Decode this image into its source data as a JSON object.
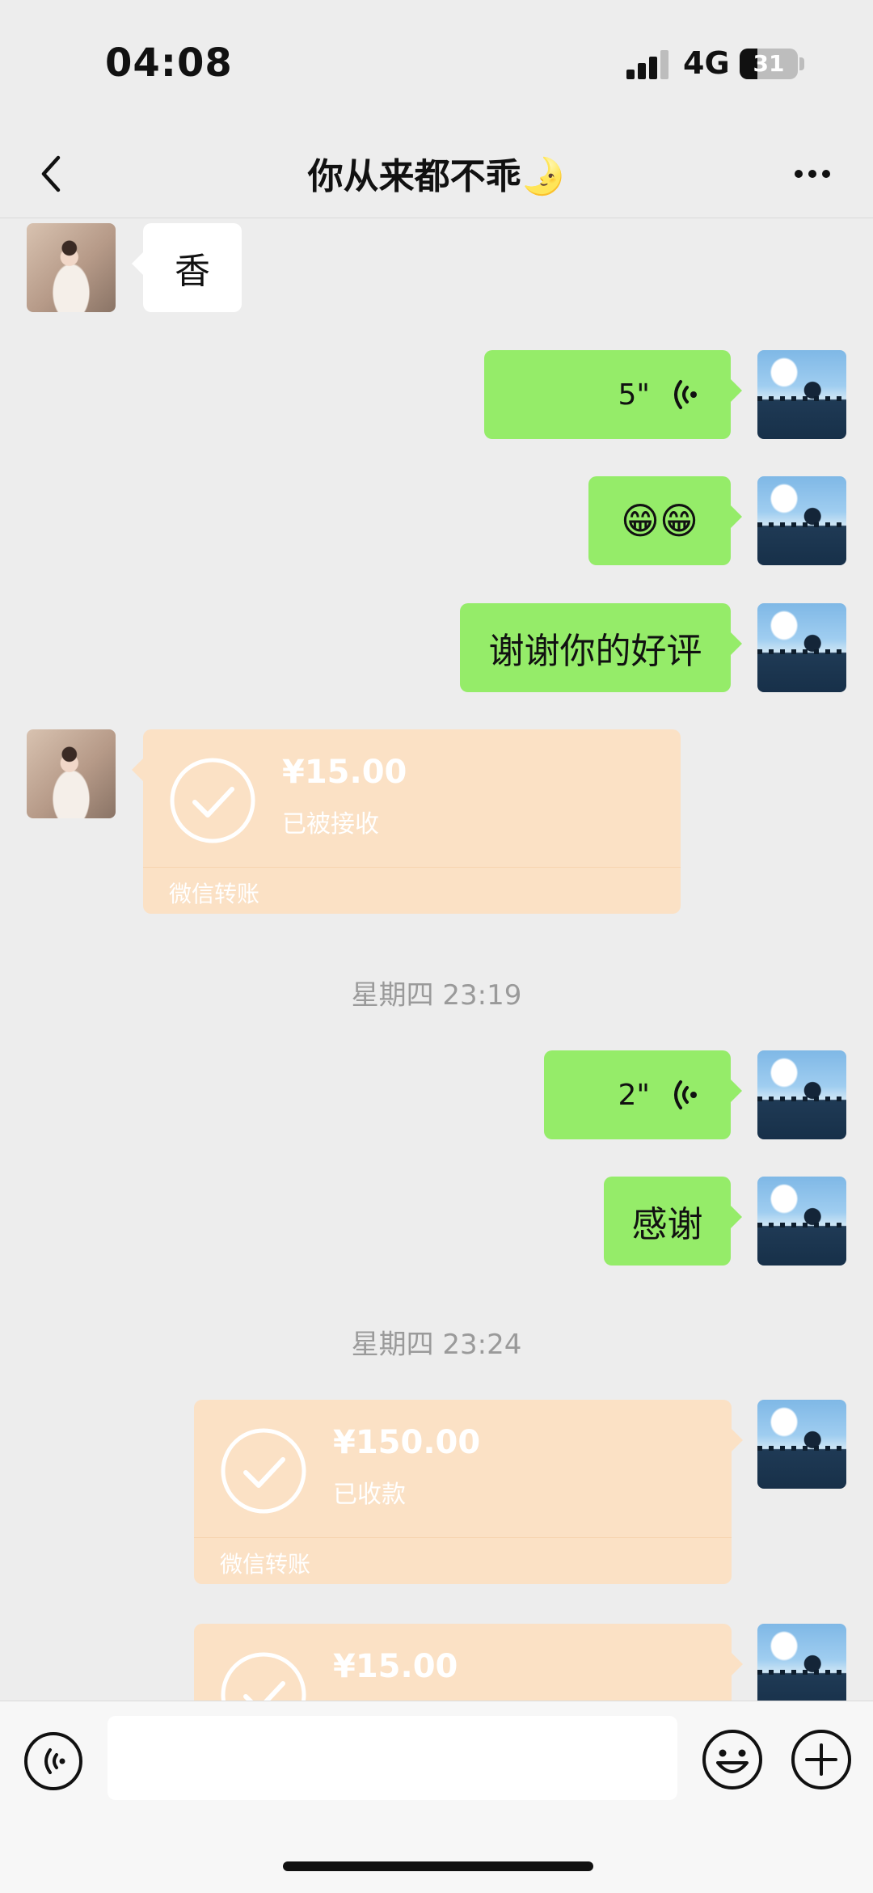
{
  "status_bar": {
    "time": "04:08",
    "network": "4G",
    "battery": "31"
  },
  "header": {
    "title": "你从来都不乖🌛"
  },
  "messages": [
    {
      "side": "left",
      "type": "text",
      "text": "香"
    },
    {
      "side": "right",
      "type": "voice",
      "duration": "5\""
    },
    {
      "side": "right",
      "type": "emoji",
      "text": "😁😁"
    },
    {
      "side": "right",
      "type": "text",
      "text": "谢谢你的好评"
    },
    {
      "side": "left",
      "type": "transfer",
      "amount": "¥15.00",
      "status": "已被接收",
      "brand": "微信转账"
    },
    {
      "type": "timestamp",
      "text": "星期四 23:19"
    },
    {
      "side": "right",
      "type": "voice",
      "duration": "2\""
    },
    {
      "side": "right",
      "type": "text",
      "text": "感谢"
    },
    {
      "type": "timestamp",
      "text": "星期四 23:24"
    },
    {
      "side": "right",
      "type": "transfer",
      "amount": "¥150.00",
      "status": "已收款",
      "brand": "微信转账"
    },
    {
      "side": "right",
      "type": "transfer",
      "amount": "¥15.00"
    }
  ],
  "composer": {
    "placeholder": ""
  },
  "colors": {
    "background": "#ededed",
    "bubble_green": "#95ec69",
    "bubble_white": "#ffffff",
    "transfer_bg": "#fbe1c5"
  },
  "icons": [
    "back-arrow-icon",
    "more-dots-icon",
    "voice-wave-icon",
    "check-circle-icon",
    "voice-toggle-icon",
    "emoji-icon",
    "plus-icon"
  ]
}
